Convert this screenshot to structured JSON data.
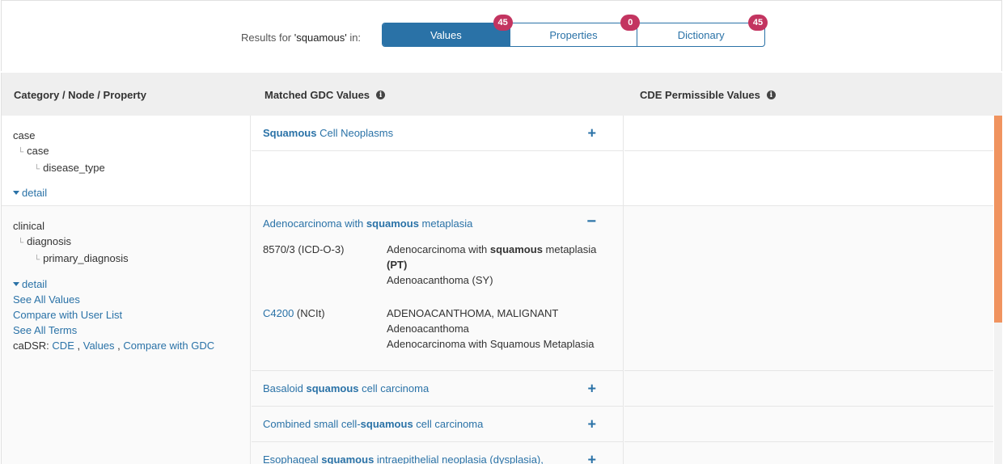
{
  "header": {
    "results_prefix": "Results for ",
    "search_term": "'squamous'",
    "results_suffix": " in:",
    "tabs": [
      {
        "label": "Values",
        "count": "45",
        "active": true
      },
      {
        "label": "Properties",
        "count": "0",
        "active": false
      },
      {
        "label": "Dictionary",
        "count": "45",
        "active": false
      }
    ]
  },
  "table": {
    "columns": [
      "Category / Node / Property",
      "Matched GDC Values",
      "CDE Permissible Values"
    ],
    "rows": [
      {
        "category": "case",
        "node": "case",
        "property": "disease_type",
        "detail_label": "detail",
        "matches": [
          {
            "pre": "",
            "hl": "Squamous",
            "post": " Cell Neoplasms",
            "toggle": "+"
          }
        ]
      },
      {
        "category": "clinical",
        "node": "diagnosis",
        "property": "primary_diagnosis",
        "detail_label": "detail",
        "links": {
          "see_all_values": "See All Values",
          "compare_user_list": "Compare with User List",
          "see_all_terms": "See All Terms",
          "cadsr_label": "caDSR:",
          "cde": "CDE",
          "values": "Values",
          "compare_gdc": "Compare with GDC",
          "sep": ","
        },
        "expanded": {
          "pre": "Adenocarcinoma with ",
          "hl": "squamous",
          "post": " metaplasia",
          "toggle": "−",
          "synonyms": [
            {
              "code": "8570/3 (ICD-O-3)",
              "code_link": "",
              "code_suffix": "",
              "term1_pre": "Adenocarcinoma with ",
              "term1_hl": "squamous",
              "term1_post": " metaplasia",
              "term1_tag": "(PT)",
              "term2": "Adenoacanthoma (SY)"
            },
            {
              "code_link": "C4200",
              "code_suffix": " (NCIt)",
              "terms": [
                "ADENOACANTHOMA, MALIGNANT",
                "Adenoacanthoma",
                "Adenocarcinoma with Squamous Metaplasia"
              ]
            }
          ]
        },
        "matches": [
          {
            "pre": "Basaloid ",
            "hl": "squamous",
            "post": " cell carcinoma",
            "toggle": "+"
          },
          {
            "pre": "Combined small cell-",
            "hl": "squamous",
            "post": " cell carcinoma",
            "toggle": "+"
          },
          {
            "pre": "Esophageal ",
            "hl": "squamous",
            "post": " intraepithelial neoplasia (dysplasia),",
            "toggle": "+"
          }
        ]
      }
    ]
  },
  "colors": {
    "primary": "#2a72a7",
    "badge": "#c33460",
    "scroll_thumb": "#f0935f"
  }
}
